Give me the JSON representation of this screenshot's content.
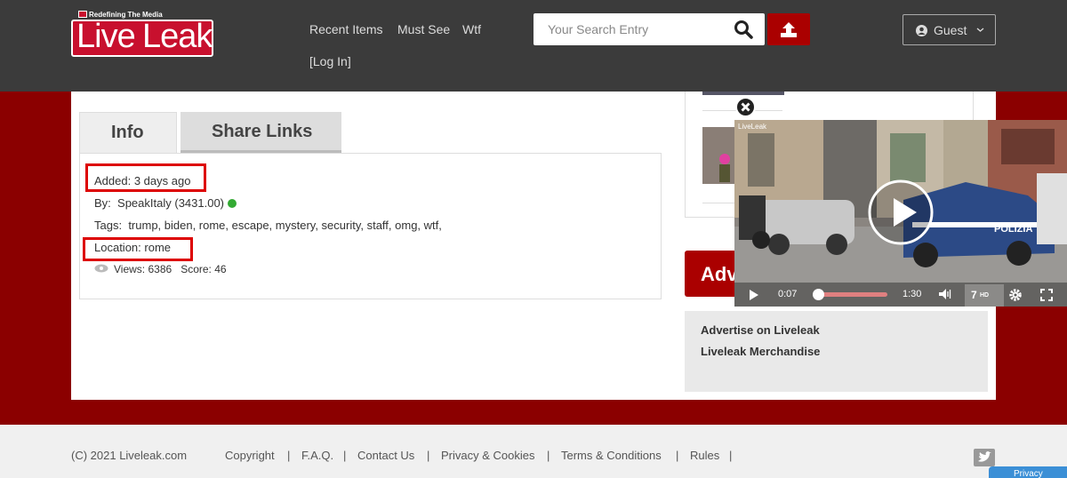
{
  "header": {
    "logo_tagline": "Redefining The Media",
    "logo_word1": "Live",
    "logo_word2": "Leak",
    "nav": [
      "Recent Items",
      "Must See",
      "Wtf"
    ],
    "login": "[Log In]",
    "search_placeholder": "Your Search Entry",
    "guest_label": "Guest"
  },
  "tabs": {
    "info": "Info",
    "share": "Share Links"
  },
  "info": {
    "added_label": "Added:",
    "added_value": "3 days ago",
    "by_label": "By:",
    "by_user": "SpeakItaly",
    "by_score": "(3431.00)",
    "tags_label": "Tags:",
    "tags": "trump, biden, rome, escape, mystery, security, staff, omg, wtf,",
    "location_label": "Location:",
    "location_value": "rome",
    "views_label": "Views:",
    "views_value": "6386",
    "score_label": "Score:",
    "score_value": "46"
  },
  "sidebar": {
    "adv_banner": "Adv",
    "link1": "Advertise on Liveleak",
    "link2": "Liveleak Merchandise"
  },
  "video": {
    "current_time": "0:07",
    "duration": "1:30",
    "quality_num": "7",
    "quality_label": "HD",
    "progress": 0.08,
    "watermark": "LiveLeak",
    "plate_text": "POLIZIA"
  },
  "footer": {
    "copyright": "(C) 2021 Liveleak.com",
    "links": [
      "Copyright",
      "F.A.Q.",
      "Contact Us",
      "Privacy & Cookies",
      "Terms & Conditions",
      "Rules"
    ],
    "privacy_badge": "Privacy"
  },
  "colors": {
    "brand_red": "#8b0000",
    "header_bg": "#3b3b3b",
    "online_green": "#33aa33"
  }
}
